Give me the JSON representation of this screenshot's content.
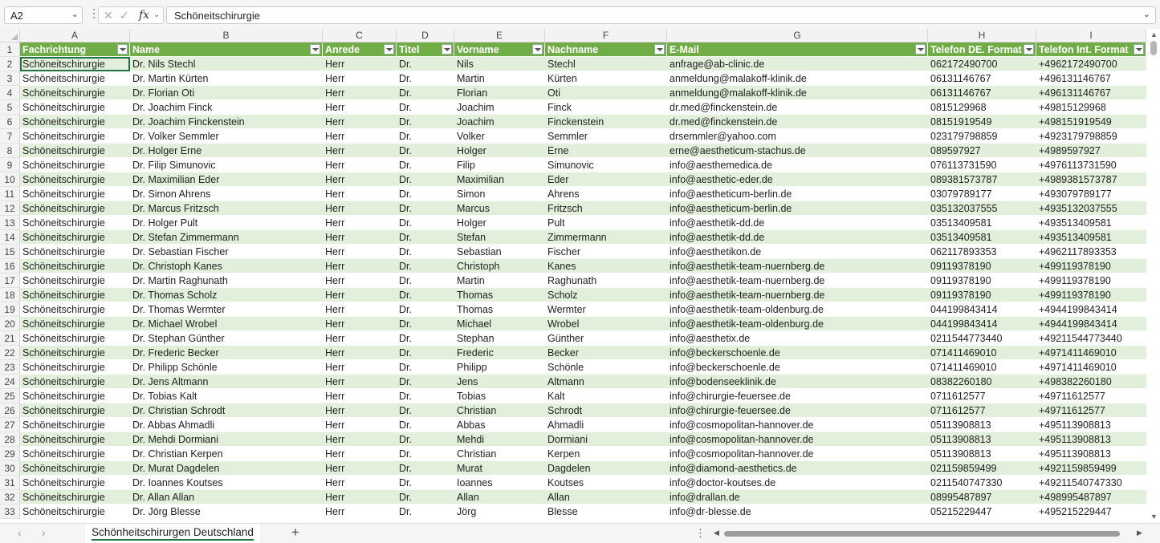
{
  "formula_bar": {
    "name_box": "A2",
    "cancel_icon": "✕",
    "enter_icon": "✓",
    "fx_label": "fx",
    "formula": "Schöneitschirurgie"
  },
  "columns": [
    {
      "letter": "A",
      "header": "Fachrichtung"
    },
    {
      "letter": "B",
      "header": "Name"
    },
    {
      "letter": "C",
      "header": "Anrede"
    },
    {
      "letter": "D",
      "header": "Titel"
    },
    {
      "letter": "E",
      "header": "Vorname"
    },
    {
      "letter": "F",
      "header": "Nachname"
    },
    {
      "letter": "G",
      "header": "E-Mail"
    },
    {
      "letter": "H",
      "header": "Telefon DE. Format"
    },
    {
      "letter": "I",
      "header": "Telefon Int. Format"
    }
  ],
  "rows": [
    {
      "num": "2",
      "cells": [
        "Schöneitschirurgie",
        "Dr. Nils Stechl",
        "Herr",
        "Dr.",
        "Nils",
        "Stechl",
        "anfrage@ab-clinic.de",
        "062172490700",
        "+4962172490700"
      ]
    },
    {
      "num": "3",
      "cells": [
        "Schöneitschirurgie",
        "Dr. Martin Kürten",
        "Herr",
        "Dr.",
        "Martin",
        "Kürten",
        "anmeldung@malakoff-klinik.de",
        "06131146767",
        "+496131146767"
      ]
    },
    {
      "num": "4",
      "cells": [
        "Schöneitschirurgie",
        "Dr. Florian Oti",
        "Herr",
        "Dr.",
        "Florian",
        "Oti",
        "anmeldung@malakoff-klinik.de",
        "06131146767",
        "+496131146767"
      ]
    },
    {
      "num": "5",
      "cells": [
        "Schöneitschirurgie",
        "Dr. Joachim Finck",
        "Herr",
        "Dr.",
        "Joachim",
        "Finck",
        "dr.med@finckenstein.de",
        "0815129968",
        "+49815129968"
      ]
    },
    {
      "num": "6",
      "cells": [
        "Schöneitschirurgie",
        "Dr. Joachim Finckenstein",
        "Herr",
        "Dr.",
        "Joachim",
        "Finckenstein",
        "dr.med@finckenstein.de",
        "08151919549",
        "+498151919549"
      ]
    },
    {
      "num": "7",
      "cells": [
        "Schöneitschirurgie",
        "Dr. Volker Semmler",
        "Herr",
        "Dr.",
        "Volker",
        "Semmler",
        "drsemmler@yahoo.com",
        "023179798859",
        "+4923179798859"
      ]
    },
    {
      "num": "8",
      "cells": [
        "Schöneitschirurgie",
        "Dr. Holger Erne",
        "Herr",
        "Dr.",
        "Holger",
        "Erne",
        "erne@aestheticum-stachus.de",
        "089597927",
        "+4989597927"
      ]
    },
    {
      "num": "9",
      "cells": [
        "Schöneitschirurgie",
        "Dr. Filip Simunovic",
        "Herr",
        "Dr.",
        "Filip",
        "Simunovic",
        "info@aesthemedica.de",
        "076113731590",
        "+4976113731590"
      ]
    },
    {
      "num": "10",
      "cells": [
        "Schöneitschirurgie",
        "Dr. Maximilian Eder",
        "Herr",
        "Dr.",
        "Maximilian",
        "Eder",
        "info@aesthetic-eder.de",
        "089381573787",
        "+4989381573787"
      ]
    },
    {
      "num": "11",
      "cells": [
        "Schöneitschirurgie",
        "Dr. Simon Ahrens",
        "Herr",
        "Dr.",
        "Simon",
        "Ahrens",
        "info@aestheticum-berlin.de",
        "03079789177",
        "+493079789177"
      ]
    },
    {
      "num": "12",
      "cells": [
        "Schöneitschirurgie",
        "Dr. Marcus Fritzsch",
        "Herr",
        "Dr.",
        "Marcus",
        "Fritzsch",
        "info@aestheticum-berlin.de",
        "035132037555",
        "+4935132037555"
      ]
    },
    {
      "num": "13",
      "cells": [
        "Schöneitschirurgie",
        "Dr. Holger Pult",
        "Herr",
        "Dr.",
        "Holger",
        "Pult",
        "info@aesthetik-dd.de",
        "03513409581",
        "+493513409581"
      ]
    },
    {
      "num": "14",
      "cells": [
        "Schöneitschirurgie",
        "Dr. Stefan Zimmermann",
        "Herr",
        "Dr.",
        "Stefan",
        "Zimmermann",
        "info@aesthetik-dd.de",
        "03513409581",
        "+493513409581"
      ]
    },
    {
      "num": "15",
      "cells": [
        "Schöneitschirurgie",
        "Dr. Sebastian Fischer",
        "Herr",
        "Dr.",
        "Sebastian",
        "Fischer",
        "info@aesthetikon.de",
        "062117893353",
        "+4962117893353"
      ]
    },
    {
      "num": "16",
      "cells": [
        "Schöneitschirurgie",
        "Dr. Christoph Kanes",
        "Herr",
        "Dr.",
        "Christoph",
        "Kanes",
        "info@aesthetik-team-nuernberg.de",
        "09119378190",
        "+499119378190"
      ]
    },
    {
      "num": "17",
      "cells": [
        "Schöneitschirurgie",
        "Dr. Martin Raghunath",
        "Herr",
        "Dr.",
        "Martin",
        "Raghunath",
        "info@aesthetik-team-nuernberg.de",
        "09119378190",
        "+499119378190"
      ]
    },
    {
      "num": "18",
      "cells": [
        "Schöneitschirurgie",
        "Dr. Thomas Scholz",
        "Herr",
        "Dr.",
        "Thomas",
        "Scholz",
        "info@aesthetik-team-nuernberg.de",
        "09119378190",
        "+499119378190"
      ]
    },
    {
      "num": "19",
      "cells": [
        "Schöneitschirurgie",
        "Dr. Thomas Wermter",
        "Herr",
        "Dr.",
        "Thomas",
        "Wermter",
        "info@aesthetik-team-oldenburg.de",
        "044199843414",
        "+4944199843414"
      ]
    },
    {
      "num": "20",
      "cells": [
        "Schöneitschirurgie",
        "Dr. Michael Wrobel",
        "Herr",
        "Dr.",
        "Michael",
        "Wrobel",
        "info@aesthetik-team-oldenburg.de",
        "044199843414",
        "+4944199843414"
      ]
    },
    {
      "num": "21",
      "cells": [
        "Schöneitschirurgie",
        "Dr. Stephan Günther",
        "Herr",
        "Dr.",
        "Stephan",
        "Günther",
        "info@aesthetix.de",
        "0211544773440",
        "+49211544773440"
      ]
    },
    {
      "num": "22",
      "cells": [
        "Schöneitschirurgie",
        "Dr. Frederic Becker",
        "Herr",
        "Dr.",
        "Frederic",
        "Becker",
        "info@beckerschoenle.de",
        "071411469010",
        "+4971411469010"
      ]
    },
    {
      "num": "23",
      "cells": [
        "Schöneitschirurgie",
        "Dr. Philipp Schönle",
        "Herr",
        "Dr.",
        "Philipp",
        "Schönle",
        "info@beckerschoenle.de",
        "071411469010",
        "+4971411469010"
      ]
    },
    {
      "num": "24",
      "cells": [
        "Schöneitschirurgie",
        "Dr. Jens Altmann",
        "Herr",
        "Dr.",
        "Jens",
        "Altmann",
        "info@bodenseeklinik.de",
        "08382260180",
        "+498382260180"
      ]
    },
    {
      "num": "25",
      "cells": [
        "Schöneitschirurgie",
        "Dr. Tobias Kalt",
        "Herr",
        "Dr.",
        "Tobias",
        "Kalt",
        "info@chirurgie-feuersee.de",
        "0711612577",
        "+49711612577"
      ]
    },
    {
      "num": "26",
      "cells": [
        "Schöneitschirurgie",
        "Dr. Christian Schrodt",
        "Herr",
        "Dr.",
        "Christian",
        "Schrodt",
        "info@chirurgie-feuersee.de",
        "0711612577",
        "+49711612577"
      ]
    },
    {
      "num": "27",
      "cells": [
        "Schöneitschirurgie",
        "Dr. Abbas Ahmadli",
        "Herr",
        "Dr.",
        "Abbas",
        "Ahmadli",
        "info@cosmopolitan-hannover.de",
        "05113908813",
        "+495113908813"
      ]
    },
    {
      "num": "28",
      "cells": [
        "Schöneitschirurgie",
        "Dr. Mehdi Dormiani",
        "Herr",
        "Dr.",
        "Mehdi",
        "Dormiani",
        "info@cosmopolitan-hannover.de",
        "05113908813",
        "+495113908813"
      ]
    },
    {
      "num": "29",
      "cells": [
        "Schöneitschirurgie",
        "Dr. Christian Kerpen",
        "Herr",
        "Dr.",
        "Christian",
        "Kerpen",
        "info@cosmopolitan-hannover.de",
        "05113908813",
        "+495113908813"
      ]
    },
    {
      "num": "30",
      "cells": [
        "Schöneitschirurgie",
        "Dr. Murat Dagdelen",
        "Herr",
        "Dr.",
        "Murat",
        "Dagdelen",
        "info@diamond-aesthetics.de",
        "021159859499",
        "+4921159859499"
      ]
    },
    {
      "num": "31",
      "cells": [
        "Schöneitschirurgie",
        "Dr. Ioannes Koutses",
        "Herr",
        "Dr.",
        "Ioannes",
        "Koutses",
        "info@doctor-koutses.de",
        "0211540747330",
        "+49211540747330"
      ]
    },
    {
      "num": "32",
      "cells": [
        "Schöneitschirurgie",
        "Dr. Allan Allan",
        "Herr",
        "Dr.",
        "Allan",
        "Allan",
        "info@drallan.de",
        "08995487897",
        "+498995487897"
      ]
    },
    {
      "num": "33",
      "cells": [
        "Schöneitschirurgie",
        "Dr. Jörg Blesse",
        "Herr",
        "Dr.",
        "Jörg",
        "Blesse",
        "info@dr-blesse.de",
        "05215229447",
        "+495215229447"
      ]
    }
  ],
  "sheet_bar": {
    "tab_label": "Schönheitschirurgen Deutschland",
    "add_label": "+"
  },
  "colors": {
    "header_fill": "#70ad47",
    "band_fill": "#e2efda",
    "selection": "#217346"
  }
}
